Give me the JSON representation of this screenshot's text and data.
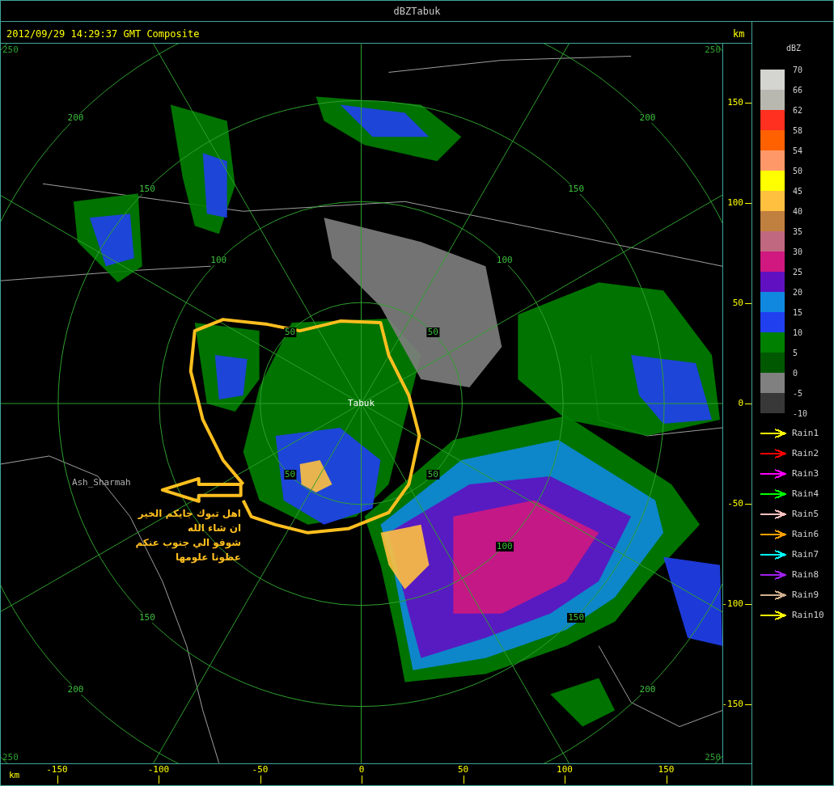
{
  "window": {
    "title": "dBZTabuk"
  },
  "header": {
    "timestamp": "2012/09/29 14:29:37 GMT Composite",
    "unit": "km"
  },
  "map": {
    "center_label": "Tabuk",
    "places": [
      {
        "name": "Ash_Sharmah"
      }
    ],
    "rings": [
      {
        "labels": [
          {
            "text": "50",
            "north": true,
            "west": true
          },
          {
            "text": "50",
            "north": true,
            "west": false
          },
          {
            "text": "50",
            "north": false,
            "west": true
          },
          {
            "text": "50",
            "north": false,
            "west": false
          }
        ]
      },
      {
        "labels": [
          {
            "text": "100",
            "north": true,
            "west": true
          },
          {
            "text": "100",
            "north": true,
            "west": false
          },
          {
            "text": "100",
            "north": false,
            "west": false
          }
        ]
      },
      {
        "labels": [
          {
            "text": "150",
            "north": true,
            "west": true
          },
          {
            "text": "150",
            "north": true,
            "west": false
          },
          {
            "text": "150",
            "north": false,
            "west": true
          },
          {
            "text": "150",
            "north": false,
            "west": false
          }
        ]
      },
      {
        "labels": [
          {
            "text": "200",
            "north": true,
            "west": true
          },
          {
            "text": "200",
            "north": true,
            "west": false
          },
          {
            "text": "200",
            "north": false,
            "west": true
          },
          {
            "text": "200",
            "north": false,
            "west": false
          }
        ]
      }
    ],
    "corner_labels": [
      "250",
      "250",
      "250",
      "250"
    ],
    "annotation": {
      "lines": [
        "اهل تبوك جايكم الخير",
        "ان شاء الله",
        "شوفو الي جنوب عنكم",
        "عطونا علومها"
      ]
    }
  },
  "x_axis": {
    "unit": "km",
    "ticks": [
      "-150",
      "-100",
      "-50",
      "0",
      "50",
      "100",
      "150"
    ]
  },
  "y_axis": {
    "ticks": [
      "150",
      "100",
      "50",
      "0",
      "-50",
      "-100",
      "-150"
    ]
  },
  "dbz_scale": {
    "title": "dBZ",
    "labels": [
      "70",
      "66",
      "62",
      "58",
      "54",
      "50",
      "45",
      "40",
      "35",
      "30",
      "25",
      "20",
      "15",
      "10",
      "5",
      "0",
      "-5",
      "-10"
    ],
    "bins": [
      {
        "color": "#d4d4d0"
      },
      {
        "color": "#b8b8b0"
      },
      {
        "color": "#ff3020"
      },
      {
        "color": "#ff6000"
      },
      {
        "color": "#ff9868"
      },
      {
        "color": "#ffff00"
      },
      {
        "color": "#ffc040"
      },
      {
        "color": "#c08040"
      },
      {
        "color": "#c06880"
      },
      {
        "color": "#d01880"
      },
      {
        "color": "#6010c0"
      },
      {
        "color": "#1088e0"
      },
      {
        "color": "#2040f0"
      },
      {
        "color": "#008000"
      },
      {
        "color": "#005800"
      },
      {
        "color": "#808080"
      },
      {
        "color": "#383838"
      }
    ]
  },
  "tracks": [
    {
      "label": "Rain1",
      "color": "#ffff00"
    },
    {
      "label": "Rain2",
      "color": "#ff0000"
    },
    {
      "label": "Rain3",
      "color": "#ff00ff"
    },
    {
      "label": "Rain4",
      "color": "#00ff00"
    },
    {
      "label": "Rain5",
      "color": "#ffc0c0"
    },
    {
      "label": "Rain6",
      "color": "#ffa000"
    },
    {
      "label": "Rain7",
      "color": "#00ffff"
    },
    {
      "label": "Rain8",
      "color": "#a020f0"
    },
    {
      "label": "Rain9",
      "color": "#d0b090"
    },
    {
      "label": "Rain10",
      "color": "#ffff00"
    }
  ]
}
